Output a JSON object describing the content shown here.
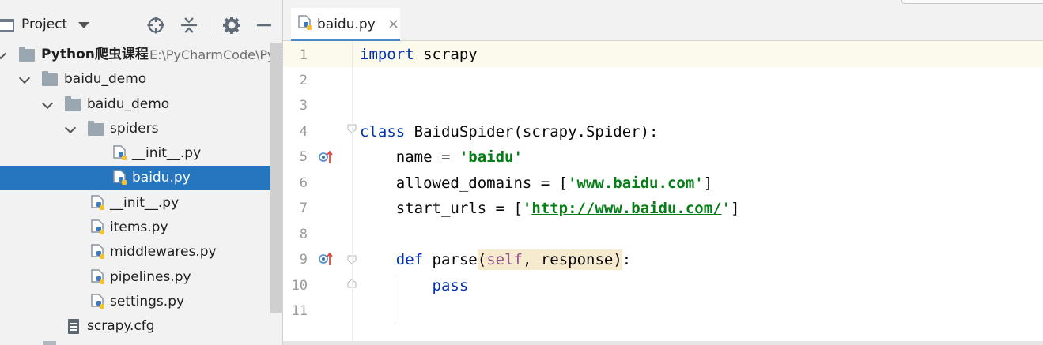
{
  "project_panel": {
    "title": "Project",
    "toolbar_icons": [
      "crosshair-icon",
      "collapse-all-icon",
      "gear-icon",
      "minimize-icon"
    ],
    "tree": [
      {
        "label": "Python爬虫课程",
        "path": "E:\\PyCharmCode\\Pyth",
        "kind": "folder",
        "expanded": true,
        "bold": true
      },
      {
        "label": "baidu_demo",
        "kind": "folder",
        "expanded": true
      },
      {
        "label": "baidu_demo",
        "kind": "folder",
        "expanded": true
      },
      {
        "label": "spiders",
        "kind": "folder",
        "expanded": true
      },
      {
        "label": "__init__.py",
        "kind": "python-file"
      },
      {
        "label": "baidu.py",
        "kind": "python-file",
        "selected": true
      },
      {
        "label": "__init__.py",
        "kind": "python-file"
      },
      {
        "label": "items.py",
        "kind": "python-file"
      },
      {
        "label": "middlewares.py",
        "kind": "python-file"
      },
      {
        "label": "pipelines.py",
        "kind": "python-file"
      },
      {
        "label": "settings.py",
        "kind": "python-file"
      },
      {
        "label": "scrapy.cfg",
        "kind": "config-file"
      }
    ]
  },
  "editor": {
    "tab": {
      "label": "baidu.py",
      "close": "×"
    },
    "line_numbers": [
      "1",
      "2",
      "3",
      "4",
      "5",
      "6",
      "7",
      "8",
      "9",
      "10",
      "11"
    ],
    "code": {
      "l1": {
        "kw": "import",
        "rest": " scrapy"
      },
      "l4": {
        "kw": "class",
        "rest": " BaiduSpider(scrapy.Spider):"
      },
      "l5": {
        "pre": "    name = ",
        "str": "'baidu'"
      },
      "l6": {
        "pre": "    allowed_domains = [",
        "str": "'www.baidu.com'",
        "post": "]"
      },
      "l7": {
        "pre": "    start_urls = [",
        "q1": "'",
        "link": "http://www.baidu.com/",
        "q2": "'",
        "post": "]"
      },
      "l9": {
        "pre": "    ",
        "kw": "def",
        "name": " parse",
        "open": "(",
        "self": "self",
        "params": ", response",
        "close": ")",
        "post": ":"
      },
      "l10": {
        "pre": "        ",
        "kw": "pass"
      }
    },
    "colors": {
      "keyword": "#0033b3",
      "string": "#067d17",
      "self": "#94558d",
      "selection": "#2675bf",
      "current_line": "#fcfaed"
    }
  }
}
